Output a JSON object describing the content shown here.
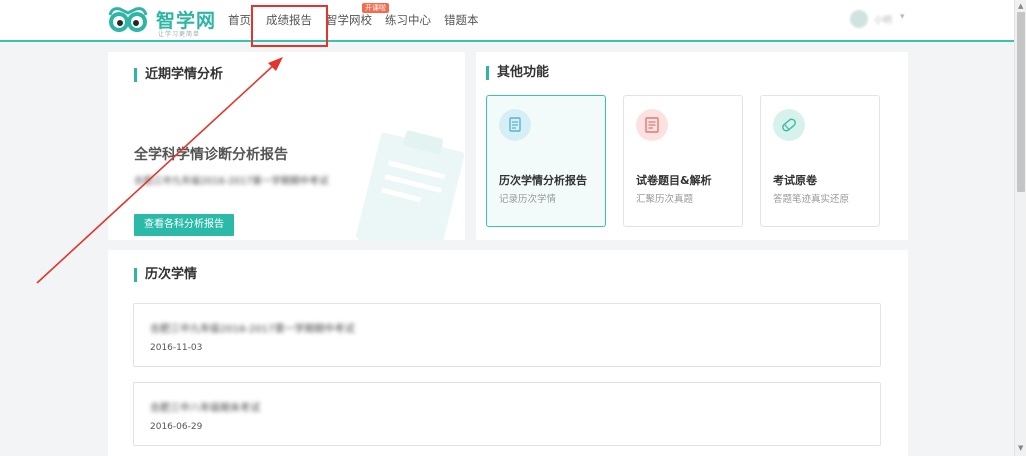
{
  "header": {
    "logo_text": "智学网",
    "logo_slogan": "让学习更简单",
    "nav": [
      {
        "label": "首页"
      },
      {
        "label": "成绩报告"
      },
      {
        "label": "智学网校"
      },
      {
        "label": "练习中心"
      },
      {
        "label": "错题本"
      }
    ],
    "nav_badge": "开课啦",
    "user_name": "小明",
    "user_caret": "▾"
  },
  "recent_analysis": {
    "section_title": "近期学情分析",
    "report_title": "全学科学情诊断分析报告",
    "exam_name_blurred": "合肥三中九年级2016-2017第一学期期中考试",
    "button_label": "查看各科分析报告"
  },
  "other_functions": {
    "section_title": "其他功能",
    "items": [
      {
        "title": "历次学情分析报告",
        "subtitle": "记录历次学情",
        "icon": "report-icon",
        "icon_bg": "#d6eef5",
        "icon_color": "#5ab3cc"
      },
      {
        "title": "试卷题目&解析",
        "subtitle": "汇聚历次真题",
        "icon": "exam-paper-icon",
        "icon_bg": "#fbe1e0",
        "icon_color": "#e07a73"
      },
      {
        "title": "考试原卷",
        "subtitle": "答题笔迹真实还原",
        "icon": "scroll-icon",
        "icon_bg": "#d7f1ec",
        "icon_color": "#3dbba7"
      }
    ]
  },
  "history": {
    "section_title": "历次学情",
    "items": [
      {
        "name_blurred": "合肥三中九年级2016-2017第一学期期中考试",
        "date": "2016-11-03"
      },
      {
        "name_blurred": "合肥三中八年级期末考试",
        "date": "2016-06-29"
      }
    ]
  },
  "colors": {
    "accent": "#2fb5a4",
    "annotation_red": "#e3352b",
    "badge_orange": "#f36b4f"
  }
}
